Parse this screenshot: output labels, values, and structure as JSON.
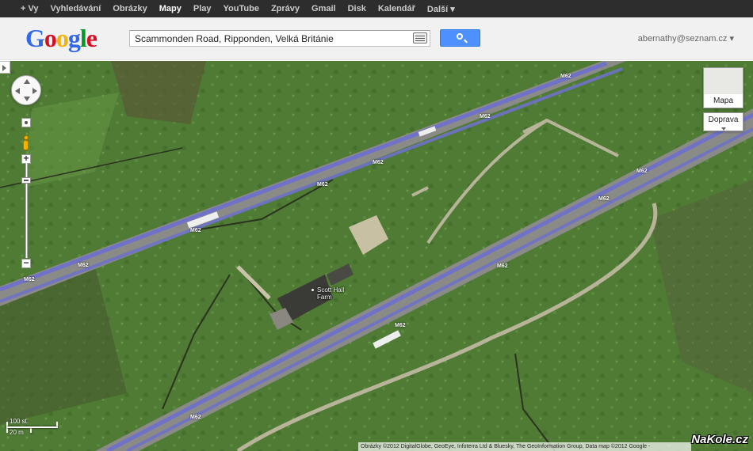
{
  "topnav": {
    "items": [
      "+ Vy",
      "Vyhledávání",
      "Obrázky",
      "Mapy",
      "Play",
      "YouTube",
      "Zprávy",
      "Gmail",
      "Disk",
      "Kalendář",
      "Další ▾"
    ],
    "active": "Mapy"
  },
  "header": {
    "logo": "Google",
    "search_value": "Scammonden Road, Ripponden, Velká Británie",
    "account": "abernathy@seznam.cz ▾"
  },
  "map": {
    "map_type_label": "Mapa",
    "traffic_label": "Doprava",
    "road_label": "M62",
    "place_name": "Scott Hall Farm",
    "scale_top": "100 st.",
    "scale_bottom": "20 m",
    "copyright": "Obrázky ©2012 DigitalGlobe, GeoEye, Infoterra Ltd & Bluesky, The GeoInformation Group, Data map ©2012 Google -",
    "watermark": "NaKole.cz"
  },
  "colors": {
    "topbar": "#2d2d2d",
    "search_button": "#4d90fe",
    "road_highlight": "#6f72c8",
    "grass": "#4f7b35"
  }
}
